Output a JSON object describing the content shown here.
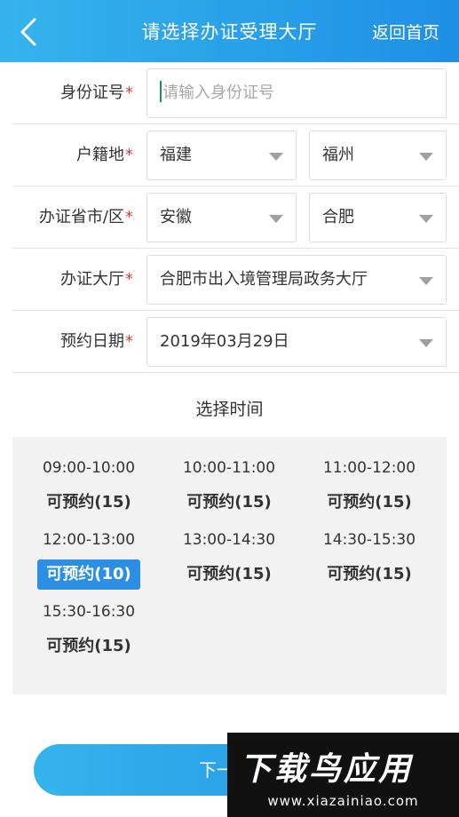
{
  "header": {
    "title": "请选择办证受理大厅",
    "home_link": "返回首页"
  },
  "form": {
    "required_mark": "*",
    "id_number": {
      "label": "身份证号",
      "placeholder": "请输入身份证号",
      "value": ""
    },
    "household": {
      "label": "户籍地",
      "province": "福建",
      "city": "福州"
    },
    "issuing_city": {
      "label": "办证省市/区",
      "province": "安徽",
      "city": "合肥"
    },
    "hall": {
      "label": "办证大厅",
      "value": "合肥市出入境管理局政务大厅"
    },
    "date": {
      "label": "预约日期",
      "value": "2019年03月29日"
    }
  },
  "time_section": {
    "title": "选择时间",
    "slots": [
      {
        "time": "09:00-10:00",
        "status": "可预约(15)",
        "selected": false
      },
      {
        "time": "10:00-11:00",
        "status": "可预约(15)",
        "selected": false
      },
      {
        "time": "11:00-12:00",
        "status": "可预约(15)",
        "selected": false
      },
      {
        "time": "12:00-13:00",
        "status": "可预约(10)",
        "selected": true
      },
      {
        "time": "13:00-14:30",
        "status": "可预约(15)",
        "selected": false
      },
      {
        "time": "14:30-15:30",
        "status": "可预约(15)",
        "selected": false
      },
      {
        "time": "15:30-16:30",
        "status": "可预约(15)",
        "selected": false
      }
    ]
  },
  "next_button": {
    "label": "下一"
  },
  "watermark": {
    "brand": "下载鸟应用",
    "url": "www.xiazainiao.com"
  },
  "colors": {
    "accent": "#1f8fe6",
    "accent_light": "#35b4ec",
    "required": "#e03b3b"
  },
  "icons": {
    "back": "chevron-left-icon",
    "dropdown": "caret-down-icon"
  }
}
